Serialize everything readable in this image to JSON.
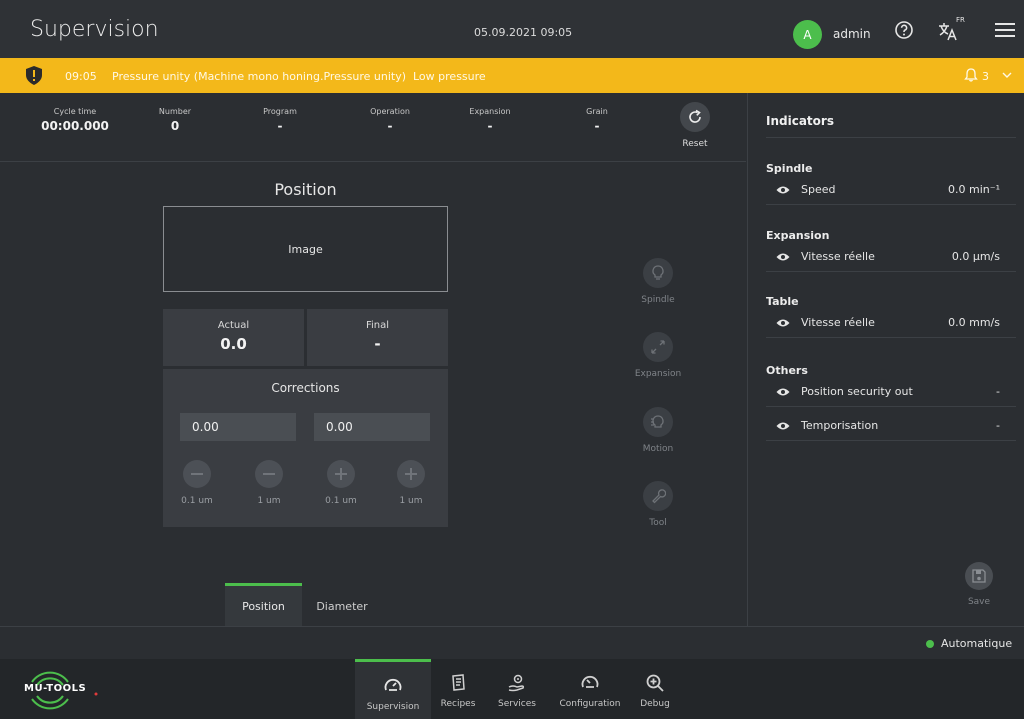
{
  "header": {
    "title": "Supervision",
    "datetime": "05.09.2021 09:05",
    "avatar_letter": "A",
    "user": "admin",
    "lang_badge": "FR"
  },
  "alarm": {
    "time": "09:05",
    "message": "Pressure unity (Machine mono honing.Pressure unity)",
    "detail": "Low pressure",
    "count": "3"
  },
  "info_strip": [
    {
      "label": "Cycle time",
      "value": "00:00.000"
    },
    {
      "label": "Number",
      "value": "0"
    },
    {
      "label": "Program",
      "value": "-"
    },
    {
      "label": "Operation",
      "value": "-"
    },
    {
      "label": "Expansion",
      "value": "-"
    },
    {
      "label": "Grain",
      "value": "-"
    }
  ],
  "reset_label": "Reset",
  "position": {
    "title": "Position",
    "image_placeholder": "Image",
    "actual_label": "Actual",
    "actual_value": "0.0",
    "final_label": "Final",
    "final_value": "-",
    "corrections_title": "Corrections",
    "corr_left": "0.00",
    "corr_right": "0.00",
    "steps": [
      "0.1 um",
      "1 um",
      "0.1 um",
      "1 um"
    ]
  },
  "side_actions": [
    "Spindle",
    "Expansion",
    "Motion",
    "Tool"
  ],
  "tabs": [
    "Position",
    "Diameter"
  ],
  "indicators": {
    "title": "Indicators",
    "groups": [
      {
        "name": "Spindle",
        "rows": [
          {
            "name": "Speed",
            "value": "0.0  min⁻¹"
          }
        ]
      },
      {
        "name": "Expansion",
        "rows": [
          {
            "name": "Vitesse réelle",
            "value": "0.0  µm/s"
          }
        ]
      },
      {
        "name": "Table",
        "rows": [
          {
            "name": "Vitesse réelle",
            "value": "0.0  mm/s"
          }
        ]
      },
      {
        "name": "Others",
        "rows": [
          {
            "name": "Position security out",
            "value": "-"
          },
          {
            "name": "Temporisation",
            "value": "-"
          }
        ]
      }
    ]
  },
  "save_label": "Save",
  "status": "Automatique",
  "logo_text": "MU-TOOLS",
  "nav": [
    "Supervision",
    "Recipes",
    "Services",
    "Configuration",
    "Debug"
  ],
  "colors": {
    "accent": "#4cbe4c",
    "alarm": "#f3b81a",
    "background": "#2b2e32"
  }
}
